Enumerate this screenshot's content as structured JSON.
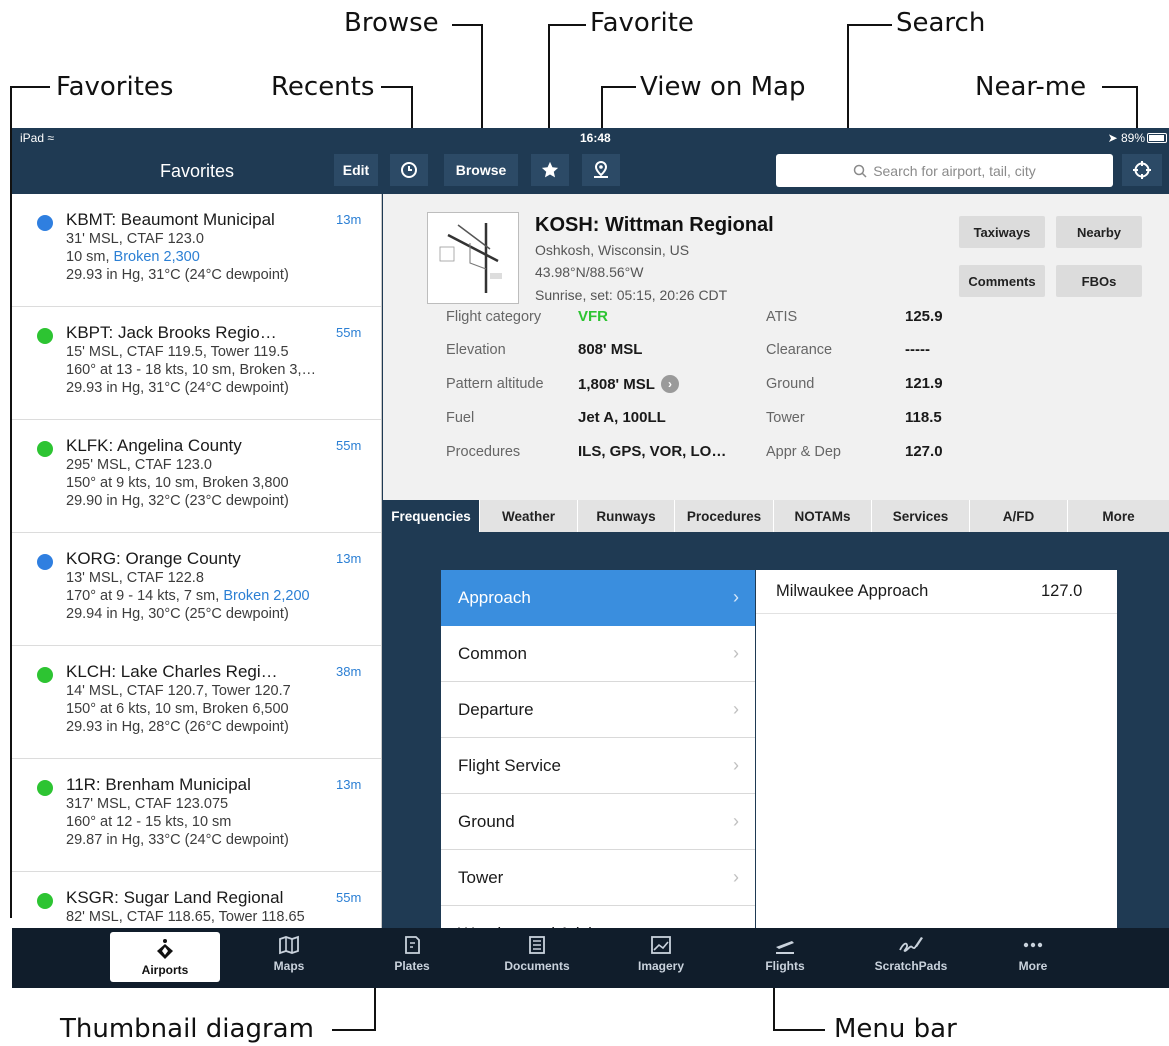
{
  "callouts": {
    "browse": "Browse",
    "favorite": "Favorite",
    "search": "Search",
    "favorites": "Favorites",
    "recents": "Recents",
    "view_on_map": "View on Map",
    "near_me": "Near-me",
    "thumbnail": "Thumbnail diagram",
    "menu_bar": "Menu bar"
  },
  "status_bar": {
    "device": "iPad",
    "time": "16:48",
    "battery": "89%"
  },
  "nav": {
    "title": "Favorites",
    "edit": "Edit",
    "browse": "Browse",
    "search_placeholder": "Search for airport, tail, city"
  },
  "favorites": [
    {
      "id": "KBMT: Beaumont Municipal",
      "age": "13m",
      "color": "#2f7fe0",
      "l1": "31' MSL, CTAF 123.0",
      "l2a": "10 sm, ",
      "l2b": "Broken 2,300",
      "l3": "29.93 in Hg, 31°C (24°C dewpoint)"
    },
    {
      "id": "KBPT: Jack Brooks Regio…",
      "age": "55m",
      "color": "#2dc432",
      "l1": "15' MSL, CTAF 119.5, Tower 119.5",
      "l2a": "160° at 13 - 18 kts, 10 sm, Broken 3,…",
      "l2b": "",
      "l3": "29.93 in Hg, 31°C (24°C dewpoint)"
    },
    {
      "id": "KLFK: Angelina County",
      "age": "55m",
      "color": "#2dc432",
      "l1": "295' MSL, CTAF 123.0",
      "l2a": "150° at 9 kts, 10 sm, Broken 3,800",
      "l2b": "",
      "l3": "29.90 in Hg, 32°C (23°C dewpoint)"
    },
    {
      "id": "KORG: Orange County",
      "age": "13m",
      "color": "#2f7fe0",
      "l1": "13' MSL, CTAF 122.8",
      "l2a": "170° at 9 - 14 kts, 7 sm, ",
      "l2b": "Broken 2,200",
      "l3": "29.94 in Hg, 30°C (25°C dewpoint)"
    },
    {
      "id": "KLCH: Lake Charles Regi…",
      "age": "38m",
      "color": "#2dc432",
      "l1": "14' MSL, CTAF 120.7, Tower 120.7",
      "l2a": "150° at 6 kts, 10 sm, Broken 6,500",
      "l2b": "",
      "l3": "29.93 in Hg, 28°C (26°C dewpoint)"
    },
    {
      "id": "11R: Brenham Municipal",
      "age": "13m",
      "color": "#2dc432",
      "l1": "317' MSL, CTAF 123.075",
      "l2a": "160° at 12 - 15 kts, 10 sm",
      "l2b": "",
      "l3": "29.87 in Hg, 33°C (24°C dewpoint)"
    },
    {
      "id": "KSGR: Sugar Land Regional",
      "age": "55m",
      "color": "#2dc432",
      "l1": "82' MSL, CTAF 118.65, Tower 118.65",
      "l2a": "",
      "l2b": "",
      "l3": ""
    }
  ],
  "airport": {
    "name": "KOSH: Wittman Regional",
    "city": "Oshkosh, Wisconsin, US",
    "coords": "43.98°N/88.56°W",
    "sun": "Sunrise, set: 05:15, 20:26 CDT",
    "buttons": {
      "taxiways": "Taxiways",
      "nearby": "Nearby",
      "comments": "Comments",
      "fbos": "FBOs"
    },
    "left_fields": [
      {
        "label": "Flight category",
        "value": "VFR"
      },
      {
        "label": "Elevation",
        "value": "808' MSL"
      },
      {
        "label": "Pattern altitude",
        "value": "1,808' MSL"
      },
      {
        "label": "Fuel",
        "value": "Jet A, 100LL"
      },
      {
        "label": "Procedures",
        "value": "ILS, GPS, VOR, LO…"
      }
    ],
    "right_fields": [
      {
        "label": "ATIS",
        "value": "125.9"
      },
      {
        "label": "Clearance",
        "value": "-----"
      },
      {
        "label": "Ground",
        "value": "121.9"
      },
      {
        "label": "Tower",
        "value": "118.5"
      },
      {
        "label": "Appr & Dep",
        "value": "127.0"
      }
    ],
    "vfr_color": "#2dc432"
  },
  "menu_tabs": [
    "Frequencies",
    "Weather",
    "Runways",
    "Procedures",
    "NOTAMs",
    "Services",
    "A/FD",
    "More"
  ],
  "freq_categories": [
    "Approach",
    "Common",
    "Departure",
    "Flight Service",
    "Ground",
    "Tower",
    "Weather and Advisory"
  ],
  "freq_items": [
    {
      "name": "Milwaukee Approach",
      "value": "127.0"
    }
  ],
  "tabbar": [
    "Airports",
    "Maps",
    "Plates",
    "Documents",
    "Imagery",
    "Flights",
    "ScratchPads",
    "More"
  ]
}
